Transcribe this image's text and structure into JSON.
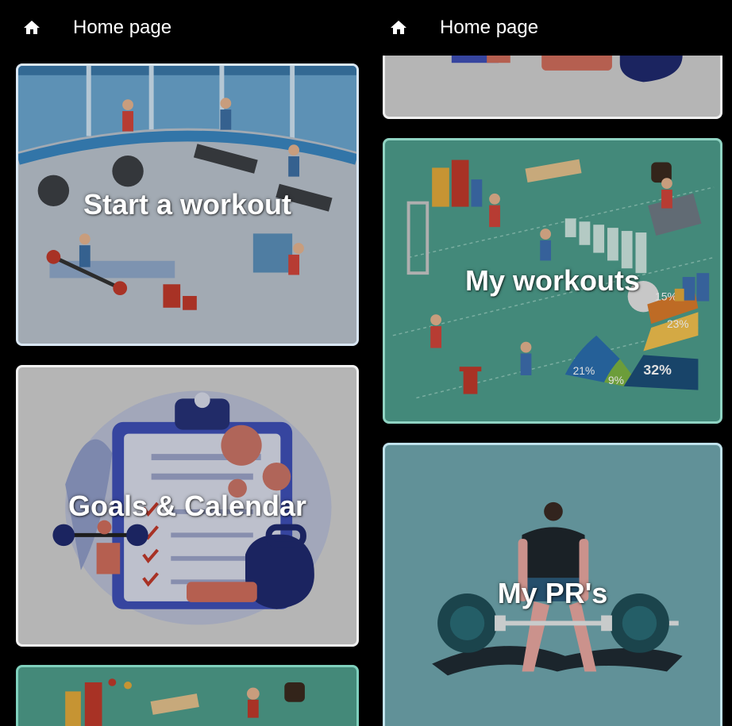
{
  "appbar": {
    "title": "Home page",
    "icon": "home-icon"
  },
  "cards": {
    "start_workout": "Start a workout",
    "goals_calendar": "Goals & Calendar",
    "my_workouts": "My workouts",
    "my_prs": "My PR's"
  },
  "my_workouts_chart_labels": [
    "15%",
    "23%",
    "21%",
    "9%",
    "32%"
  ]
}
